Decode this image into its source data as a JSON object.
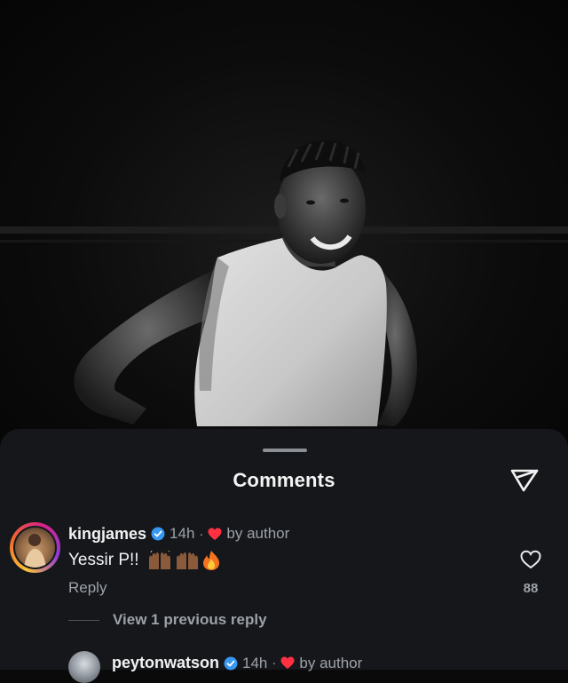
{
  "sheet": {
    "title": "Comments"
  },
  "comments": [
    {
      "username": "kingjames",
      "time": "14h",
      "separator": "·",
      "author_label": "by author",
      "text": "Yessir P!!",
      "emojis": [
        "raising-hands-emoji",
        "raising-hands-emoji",
        "fire-emoji"
      ],
      "reply_label": "Reply",
      "likes": "88"
    }
  ],
  "view_replies": {
    "label": "View 1 previous reply"
  },
  "reply_comment": {
    "username": "peytonwatson",
    "time": "14h",
    "separator": "·",
    "author_label": "by author"
  },
  "colors": {
    "sheet_bg": "#15171b",
    "primary_text": "#f2f2f2",
    "secondary_text": "#9da2a8",
    "verified_blue": "#3897f0",
    "heart_red": "#ff3040"
  }
}
